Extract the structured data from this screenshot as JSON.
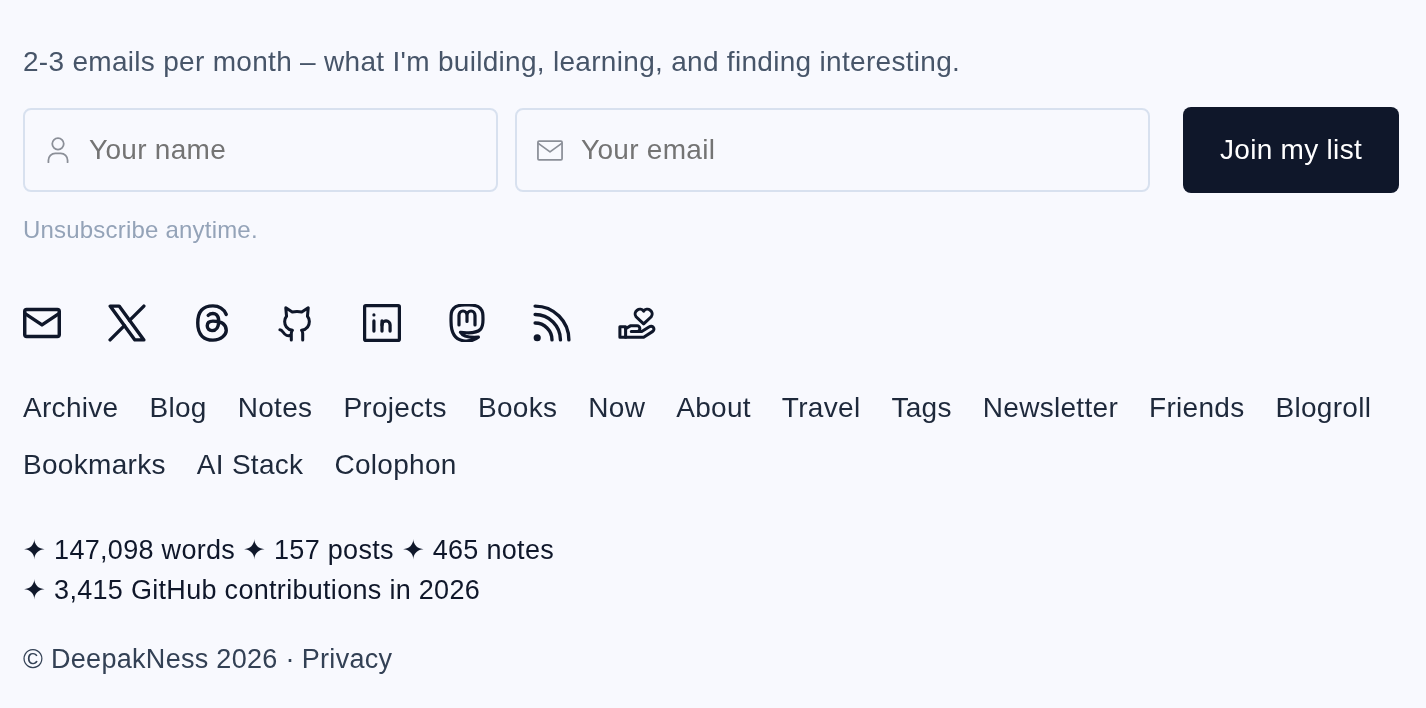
{
  "intro": "2-3 emails per month – what I'm building, learning, and finding interesting.",
  "signup": {
    "fields": [
      {
        "kind": "name",
        "placeholder": "Your name"
      },
      {
        "kind": "email",
        "placeholder": "Your email"
      }
    ],
    "button": "Join my list",
    "note": "Unsubscribe anytime."
  },
  "nav": [
    "Archive",
    "Blog",
    "Notes",
    "Projects",
    "Books",
    "Now",
    "About",
    "Travel",
    "Tags",
    "Newsletter",
    "Friends",
    "Blogroll",
    "Bookmarks",
    "AI Stack",
    "Colophon"
  ],
  "stats": [
    "✦ 147,098 words ✦ 157 posts ✦ 465 notes",
    "✦ 3,415 GitHub contributions in 2026"
  ],
  "footer": {
    "copyright": "© DeepakNess 2026 ·",
    "link": "Privacy"
  }
}
